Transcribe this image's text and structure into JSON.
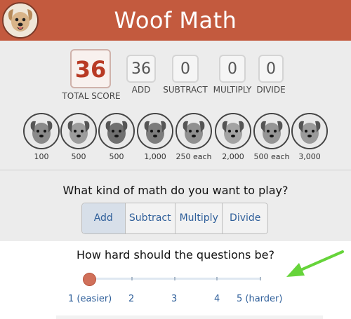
{
  "header": {
    "title": "Woof Math",
    "logo_icon": "dog-face-icon",
    "color": "#c35a3e"
  },
  "scores": {
    "total": {
      "value": "36",
      "label": "TOTAL SCORE"
    },
    "add": {
      "value": "36",
      "label": "ADD"
    },
    "subtract": {
      "value": "0",
      "label": "SUBTRACT"
    },
    "multiply": {
      "value": "0",
      "label": "MULTIPLY"
    },
    "divide": {
      "value": "0",
      "label": "DIVIDE"
    }
  },
  "badges": [
    {
      "icon": "bernese-dog-icon",
      "label": "100"
    },
    {
      "icon": "chihuahua-dog-icon",
      "label": "500"
    },
    {
      "icon": "doodle-dog-icon",
      "label": "500"
    },
    {
      "icon": "boxer-dog-icon",
      "label": "1,000"
    },
    {
      "icon": "husky-dog-icon",
      "label": "250 each"
    },
    {
      "icon": "retriever-dog-icon",
      "label": "2,000"
    },
    {
      "icon": "cat-icon",
      "label": "500 each"
    },
    {
      "icon": "trophy-dog-icon",
      "label": "3,000"
    }
  ],
  "math_question": "What kind of math do you want to play?",
  "operations": [
    {
      "label": "Add",
      "selected": true
    },
    {
      "label": "Subtract",
      "selected": false
    },
    {
      "label": "Multiply",
      "selected": false
    },
    {
      "label": "Divide",
      "selected": false
    }
  ],
  "difficulty": {
    "question": "How hard should the questions be?",
    "labels": [
      "1 (easier)",
      "2",
      "3",
      "4",
      "5 (harder)"
    ],
    "value": 1,
    "min": 1,
    "max": 5
  },
  "annotation": {
    "icon": "green-arrow-icon",
    "color": "#66d43a"
  }
}
